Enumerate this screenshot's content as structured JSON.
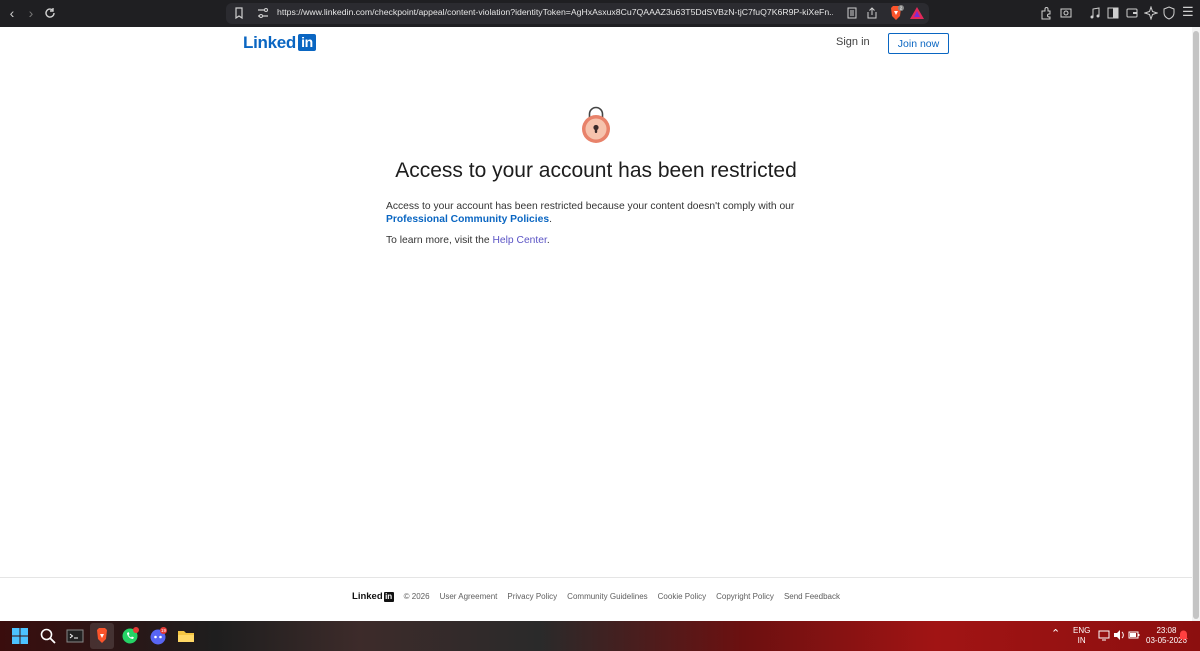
{
  "browser": {
    "url": "https://www.linkedin.com/checkpoint/appeal/content-violation?identityToken=AgHxAsxux8Cu7QAAAZ3u63T5DdSVBzN-tjC7fuQ7K6R9P-kiXeFn...",
    "brave_badge": "2"
  },
  "header": {
    "logo_text": "Linked",
    "logo_in": "in",
    "sign_in": "Sign in",
    "join_now": "Join now"
  },
  "main": {
    "title": "Access to your account has been restricted",
    "message": "Access to your account has been restricted because your content doesn't comply with our",
    "policy_link": "Professional Community Policies",
    "period": ".",
    "learn_more": "To learn more, visit the",
    "help_link": "Help Center",
    "period2": "."
  },
  "footer": {
    "logo_text": "Linked",
    "logo_in": "in",
    "copyright": "© 2026",
    "links": [
      "User Agreement",
      "Privacy Policy",
      "Community Guidelines",
      "Cookie Policy",
      "Copyright Policy",
      "Send Feedback"
    ]
  },
  "taskbar": {
    "lang_top": "ENG",
    "lang_bottom": "IN",
    "time": "23:08",
    "date": "03-05-2026",
    "discord_badge": "19"
  },
  "colors": {
    "linkedin_blue": "#0a66c2",
    "lock_orange": "#e8826a"
  }
}
